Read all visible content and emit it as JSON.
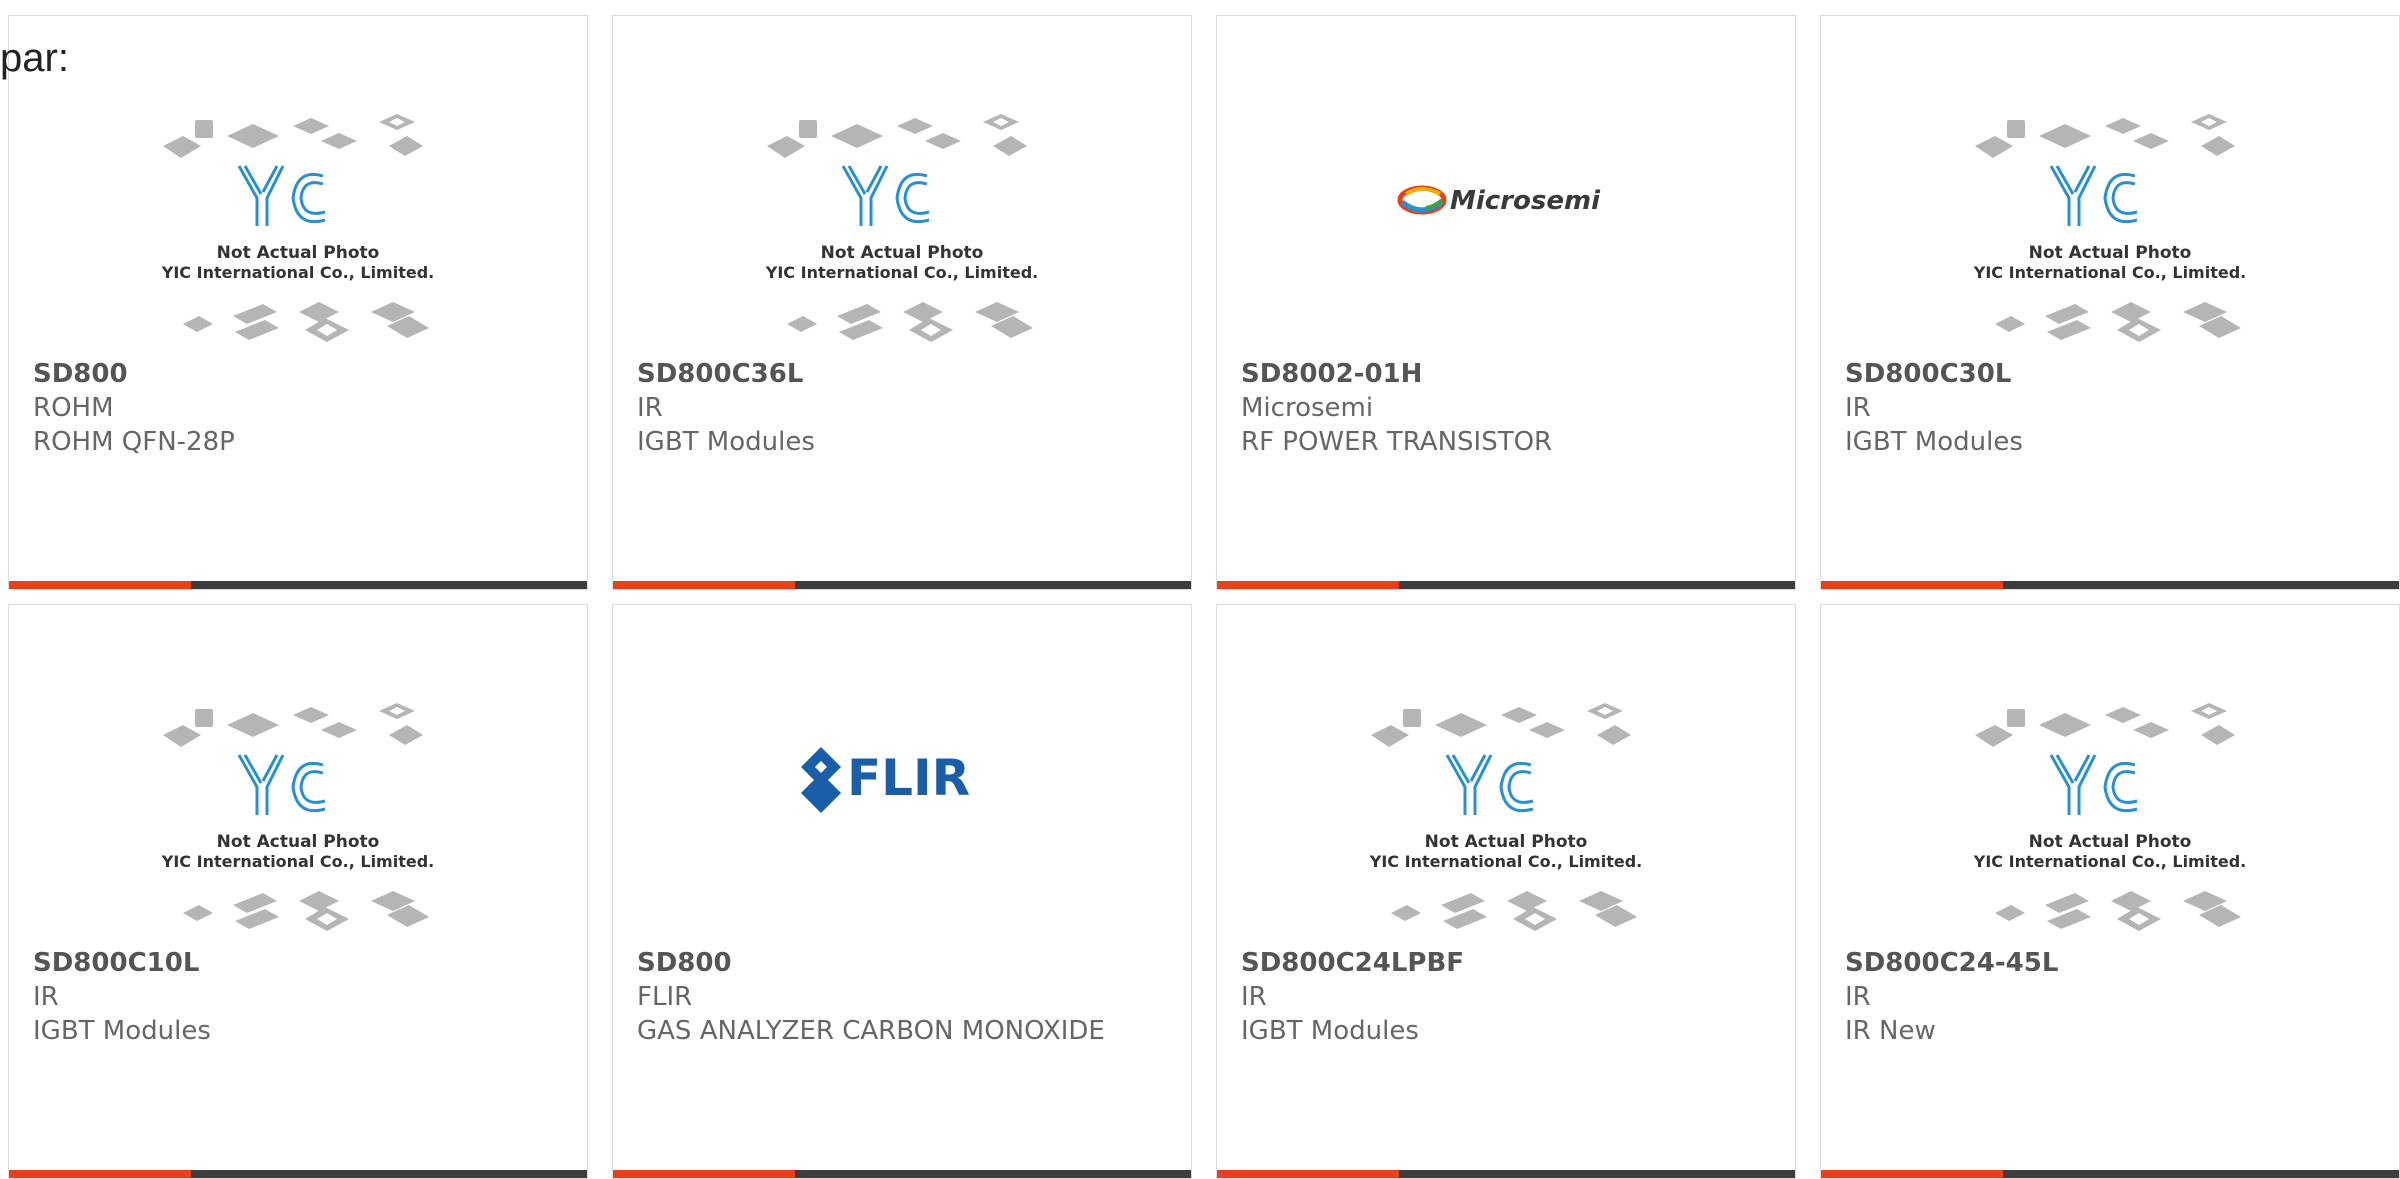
{
  "page_label": "par:",
  "cards": [
    {
      "part": "SD800",
      "manufacturer": "ROHM",
      "description": "ROHM QFN-28P",
      "image": "yic-placeholder"
    },
    {
      "part": "SD800C36L",
      "manufacturer": "IR",
      "description": "IGBT Modules",
      "image": "yic-placeholder"
    },
    {
      "part": "SD8002-01H",
      "manufacturer": "Microsemi",
      "description": "RF POWER TRANSISTOR",
      "image": "microsemi-logo"
    },
    {
      "part": "SD800C30L",
      "manufacturer": "IR",
      "description": "IGBT Modules",
      "image": "yic-placeholder"
    },
    {
      "part": "SD800C10L",
      "manufacturer": "IR",
      "description": "IGBT Modules",
      "image": "yic-placeholder"
    },
    {
      "part": "SD800",
      "manufacturer": "FLIR",
      "description": "GAS ANALYZER CARBON MONOXIDE",
      "image": "flir-logo"
    },
    {
      "part": "SD800C24LPBF",
      "manufacturer": "IR",
      "description": "IGBT Modules",
      "image": "yic-placeholder"
    },
    {
      "part": "SD800C24-45L",
      "manufacturer": "IR",
      "description": "IR New",
      "image": "yic-placeholder"
    }
  ],
  "placeholder": {
    "brand": "YIC",
    "line1": "Not Actual Photo",
    "line2": "YIC International Co., Limited."
  },
  "logos": {
    "microsemi": "Microsemi",
    "flir": "FLIR"
  },
  "colors": {
    "accent": "#e8401c",
    "bar": "#3d3d3d",
    "yic_blue": "#2a8fd0",
    "flir_blue": "#1b5ea8"
  }
}
